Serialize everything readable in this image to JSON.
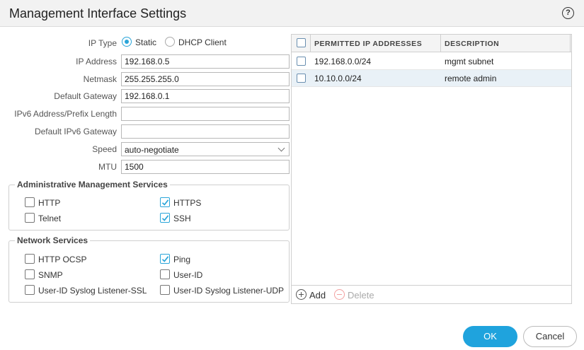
{
  "dialog": {
    "title": "Management Interface Settings",
    "help_icon": "help-icon",
    "help_glyph": "?"
  },
  "form": {
    "ip_type": {
      "label": "IP Type",
      "options": [
        {
          "label": "Static",
          "selected": true
        },
        {
          "label": "DHCP Client",
          "selected": false
        }
      ]
    },
    "ip_address": {
      "label": "IP Address",
      "value": "192.168.0.5"
    },
    "netmask": {
      "label": "Netmask",
      "value": "255.255.255.0"
    },
    "default_gateway": {
      "label": "Default Gateway",
      "value": "192.168.0.1"
    },
    "ipv6_address": {
      "label": "IPv6 Address/Prefix Length",
      "value": ""
    },
    "ipv6_gateway": {
      "label": "Default IPv6 Gateway",
      "value": ""
    },
    "speed": {
      "label": "Speed",
      "value": "auto-negotiate"
    },
    "mtu": {
      "label": "MTU",
      "value": "1500"
    }
  },
  "admin_services": {
    "title": "Administrative Management Services",
    "items": [
      {
        "label": "HTTP",
        "checked": false
      },
      {
        "label": "HTTPS",
        "checked": true
      },
      {
        "label": "Telnet",
        "checked": false
      },
      {
        "label": "SSH",
        "checked": true
      }
    ]
  },
  "network_services": {
    "title": "Network Services",
    "items": [
      {
        "label": "HTTP OCSP",
        "checked": false
      },
      {
        "label": "Ping",
        "checked": true
      },
      {
        "label": "SNMP",
        "checked": false
      },
      {
        "label": "User-ID",
        "checked": false
      },
      {
        "label": "User-ID Syslog Listener-SSL",
        "checked": false
      },
      {
        "label": "User-ID Syslog Listener-UDP",
        "checked": false
      }
    ]
  },
  "permitted_ips": {
    "columns": [
      "PERMITTED IP ADDRESSES",
      "DESCRIPTION"
    ],
    "rows": [
      {
        "address": "192.168.0.0/24",
        "description": "mgmt subnet"
      },
      {
        "address": "10.10.0.0/24",
        "description": "remote admin"
      }
    ],
    "add_label": "Add",
    "delete_label": "Delete"
  },
  "buttons": {
    "ok": "OK",
    "cancel": "Cancel"
  },
  "colors": {
    "accent": "#1fa3dd",
    "selected_row": "#e9f1f7",
    "delete_disabled": "#f2a0a0"
  }
}
